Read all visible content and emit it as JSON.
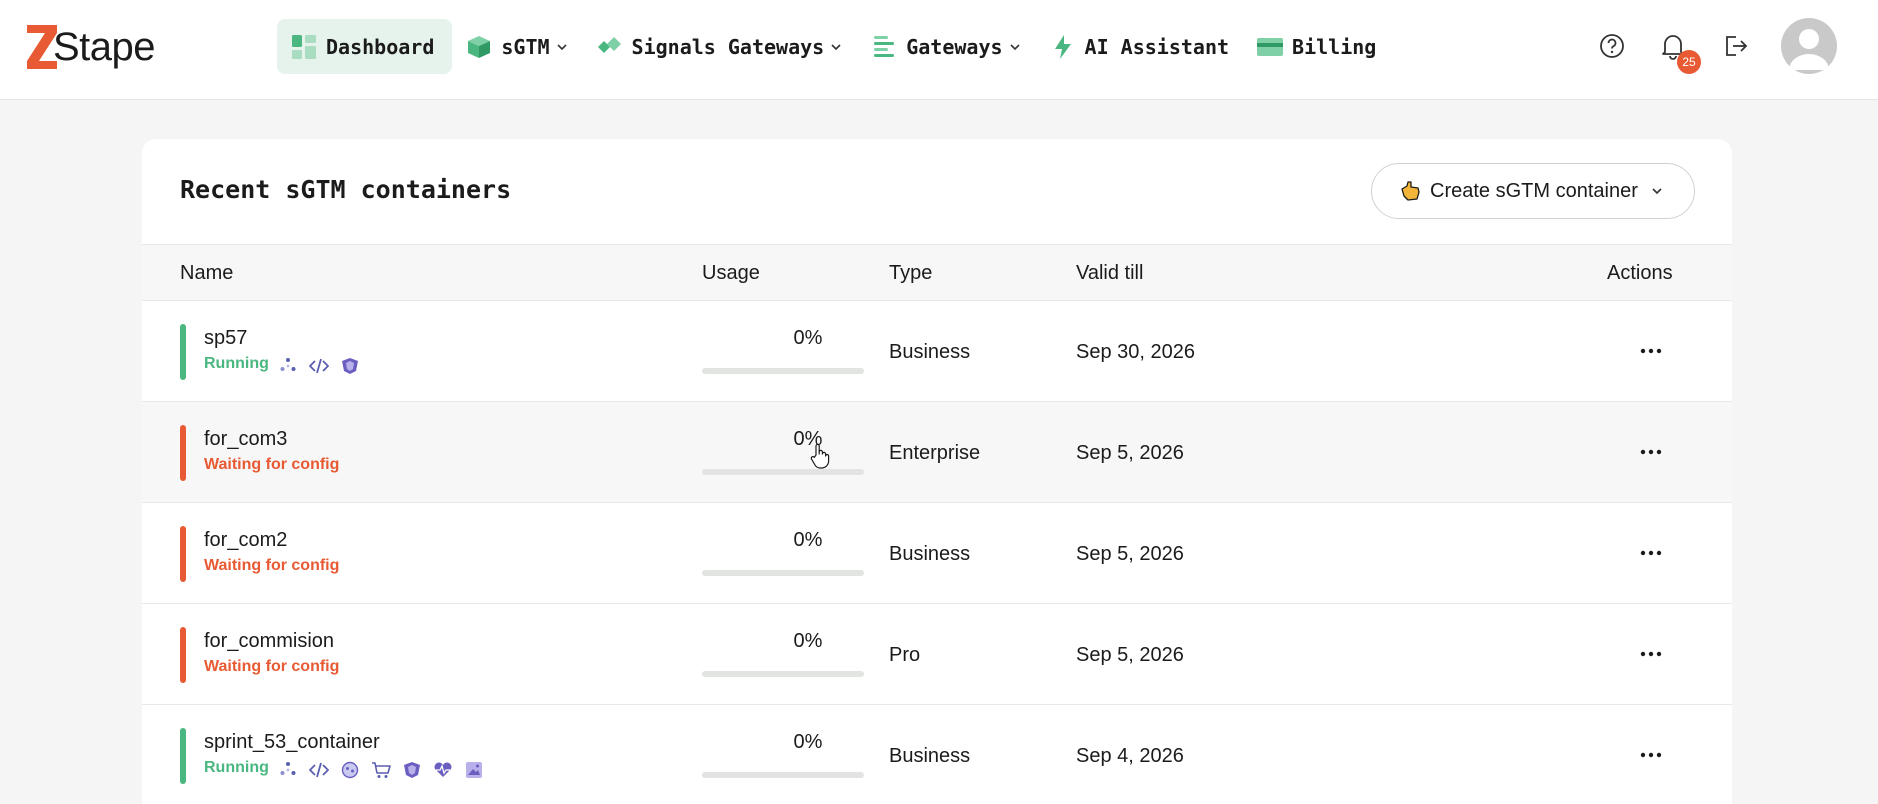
{
  "brand": {
    "name": "Stape",
    "accent": "#e85a33"
  },
  "nav": {
    "items": [
      {
        "label": "Dashboard",
        "icon": "dashboard-icon",
        "active": true,
        "has_caret": false
      },
      {
        "label": "sGTM",
        "icon": "cube-icon",
        "active": false,
        "has_caret": true
      },
      {
        "label": "Signals Gateways",
        "icon": "diamonds-icon",
        "active": false,
        "has_caret": true
      },
      {
        "label": "Gateways",
        "icon": "lines-icon",
        "active": false,
        "has_caret": true
      },
      {
        "label": "AI Assistant",
        "icon": "lightning-icon",
        "active": false,
        "has_caret": false
      },
      {
        "label": "Billing",
        "icon": "card-icon",
        "active": false,
        "has_caret": false
      }
    ]
  },
  "header_icons": [
    "help-icon",
    "bell-icon",
    "logout-icon"
  ],
  "notifications": {
    "count": "25"
  },
  "containers_card": {
    "title": "Recent sGTM containers",
    "create_button": "Create sGTM container",
    "columns": [
      "Name",
      "Usage",
      "Type",
      "Valid till",
      "Actions"
    ],
    "rows": [
      {
        "name": "sp57",
        "status": "Running",
        "status_color": "#49b77f",
        "usage": "0%",
        "usage_fraction": 0,
        "type": "Business",
        "valid_till": "Sep 30, 2026",
        "features": [
          "sparkle-icon",
          "code-icon",
          "shield-icon"
        ]
      },
      {
        "name": "for_com3",
        "status": "Waiting for config",
        "status_color": "#e85a33",
        "usage": "0%",
        "usage_fraction": 0,
        "type": "Enterprise",
        "valid_till": "Sep 5, 2026",
        "features": []
      },
      {
        "name": "for_com2",
        "status": "Waiting for config",
        "status_color": "#e85a33",
        "usage": "0%",
        "usage_fraction": 0,
        "type": "Business",
        "valid_till": "Sep 5, 2026",
        "features": []
      },
      {
        "name": "for_commision",
        "status": "Waiting for config",
        "status_color": "#e85a33",
        "usage": "0%",
        "usage_fraction": 0,
        "type": "Pro",
        "valid_till": "Sep 5, 2026",
        "features": []
      },
      {
        "name": "sprint_53_container",
        "status": "Running",
        "status_color": "#49b77f",
        "usage": "0%",
        "usage_fraction": 0,
        "type": "Business",
        "valid_till": "Sep 4, 2026",
        "features": [
          "sparkle-icon",
          "code-icon",
          "globe-icon",
          "cart-icon",
          "shield-icon",
          "pulse-icon",
          "image-icon"
        ]
      }
    ]
  }
}
